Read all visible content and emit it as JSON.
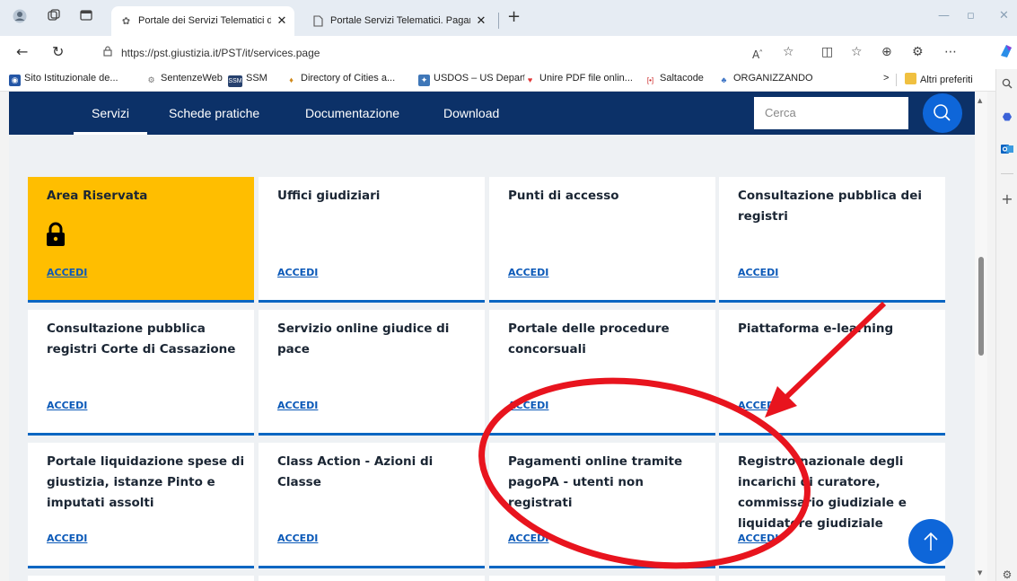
{
  "browser": {
    "tabs": [
      {
        "title": "Portale dei Servizi Telematici del Ministero della Giustizia",
        "close": "✕"
      },
      {
        "title": "Portale Servizi Telematici. Pagamenti",
        "close": "✕"
      }
    ],
    "new_tab": "+",
    "url": "https://pst.giustizia.it/PST/it/services.page",
    "favorites": [
      {
        "label": "Sito Istituzionale de...",
        "icon": "site-icon"
      },
      {
        "label": "SentenzeWeb",
        "icon": "sentenzeweb-icon"
      },
      {
        "label": "SSM",
        "icon": "ssm-icon"
      },
      {
        "label": "Directory of Cities a...",
        "icon": "directory-icon"
      },
      {
        "label": "USDOS – US Depart...",
        "icon": "usdos-icon"
      },
      {
        "label": "Unire PDF file onlin...",
        "icon": "heart-icon"
      },
      {
        "label": "Saltacode",
        "icon": "saltacode-icon"
      },
      {
        "label": "ORGANIZZANDO",
        "icon": "people-icon"
      }
    ],
    "favorites_more": ">",
    "other_favorites": "Altri preferiti"
  },
  "nav": {
    "items": [
      "Servizi",
      "Schede pratiche",
      "Documentazione",
      "Download"
    ],
    "active": "Servizi",
    "search_placeholder": "Cerca"
  },
  "cards": [
    {
      "title": "Area Riservata",
      "link": "ACCEDI",
      "highlight": true,
      "icon": "lock-icon"
    },
    {
      "title": "Uffici giudiziari",
      "link": "ACCEDI"
    },
    {
      "title": "Punti di accesso",
      "link": "ACCEDI"
    },
    {
      "title": "Consultazione pubblica dei registri",
      "link": "ACCEDI"
    },
    {
      "title": "Consultazione pubblica registri Corte di Cassazione",
      "link": "ACCEDI"
    },
    {
      "title": "Servizio online giudice di pace",
      "link": "ACCEDI"
    },
    {
      "title": "Portale delle procedure concorsuali",
      "link": "ACCEDI"
    },
    {
      "title": "Piattaforma e-learning",
      "link": "ACCEDI"
    },
    {
      "title": "Portale liquidazione spese di giustizia, istanze Pinto e imputati assolti",
      "link": "ACCEDI"
    },
    {
      "title": "Class Action - Azioni di Classe",
      "link": "ACCEDI"
    },
    {
      "title": "Pagamenti online tramite pagoPA - utenti non registrati",
      "link": "ACCEDI"
    },
    {
      "title": "Registro nazionale degli incarichi di curatore, commissario giudiziale e liquidatore giudiziale",
      "link": "ACCEDI"
    }
  ],
  "colors": {
    "nav_bg": "#0c3168",
    "accent": "#0e66d9",
    "highlight_card": "#ffbe00",
    "annotation": "#e8141e"
  }
}
